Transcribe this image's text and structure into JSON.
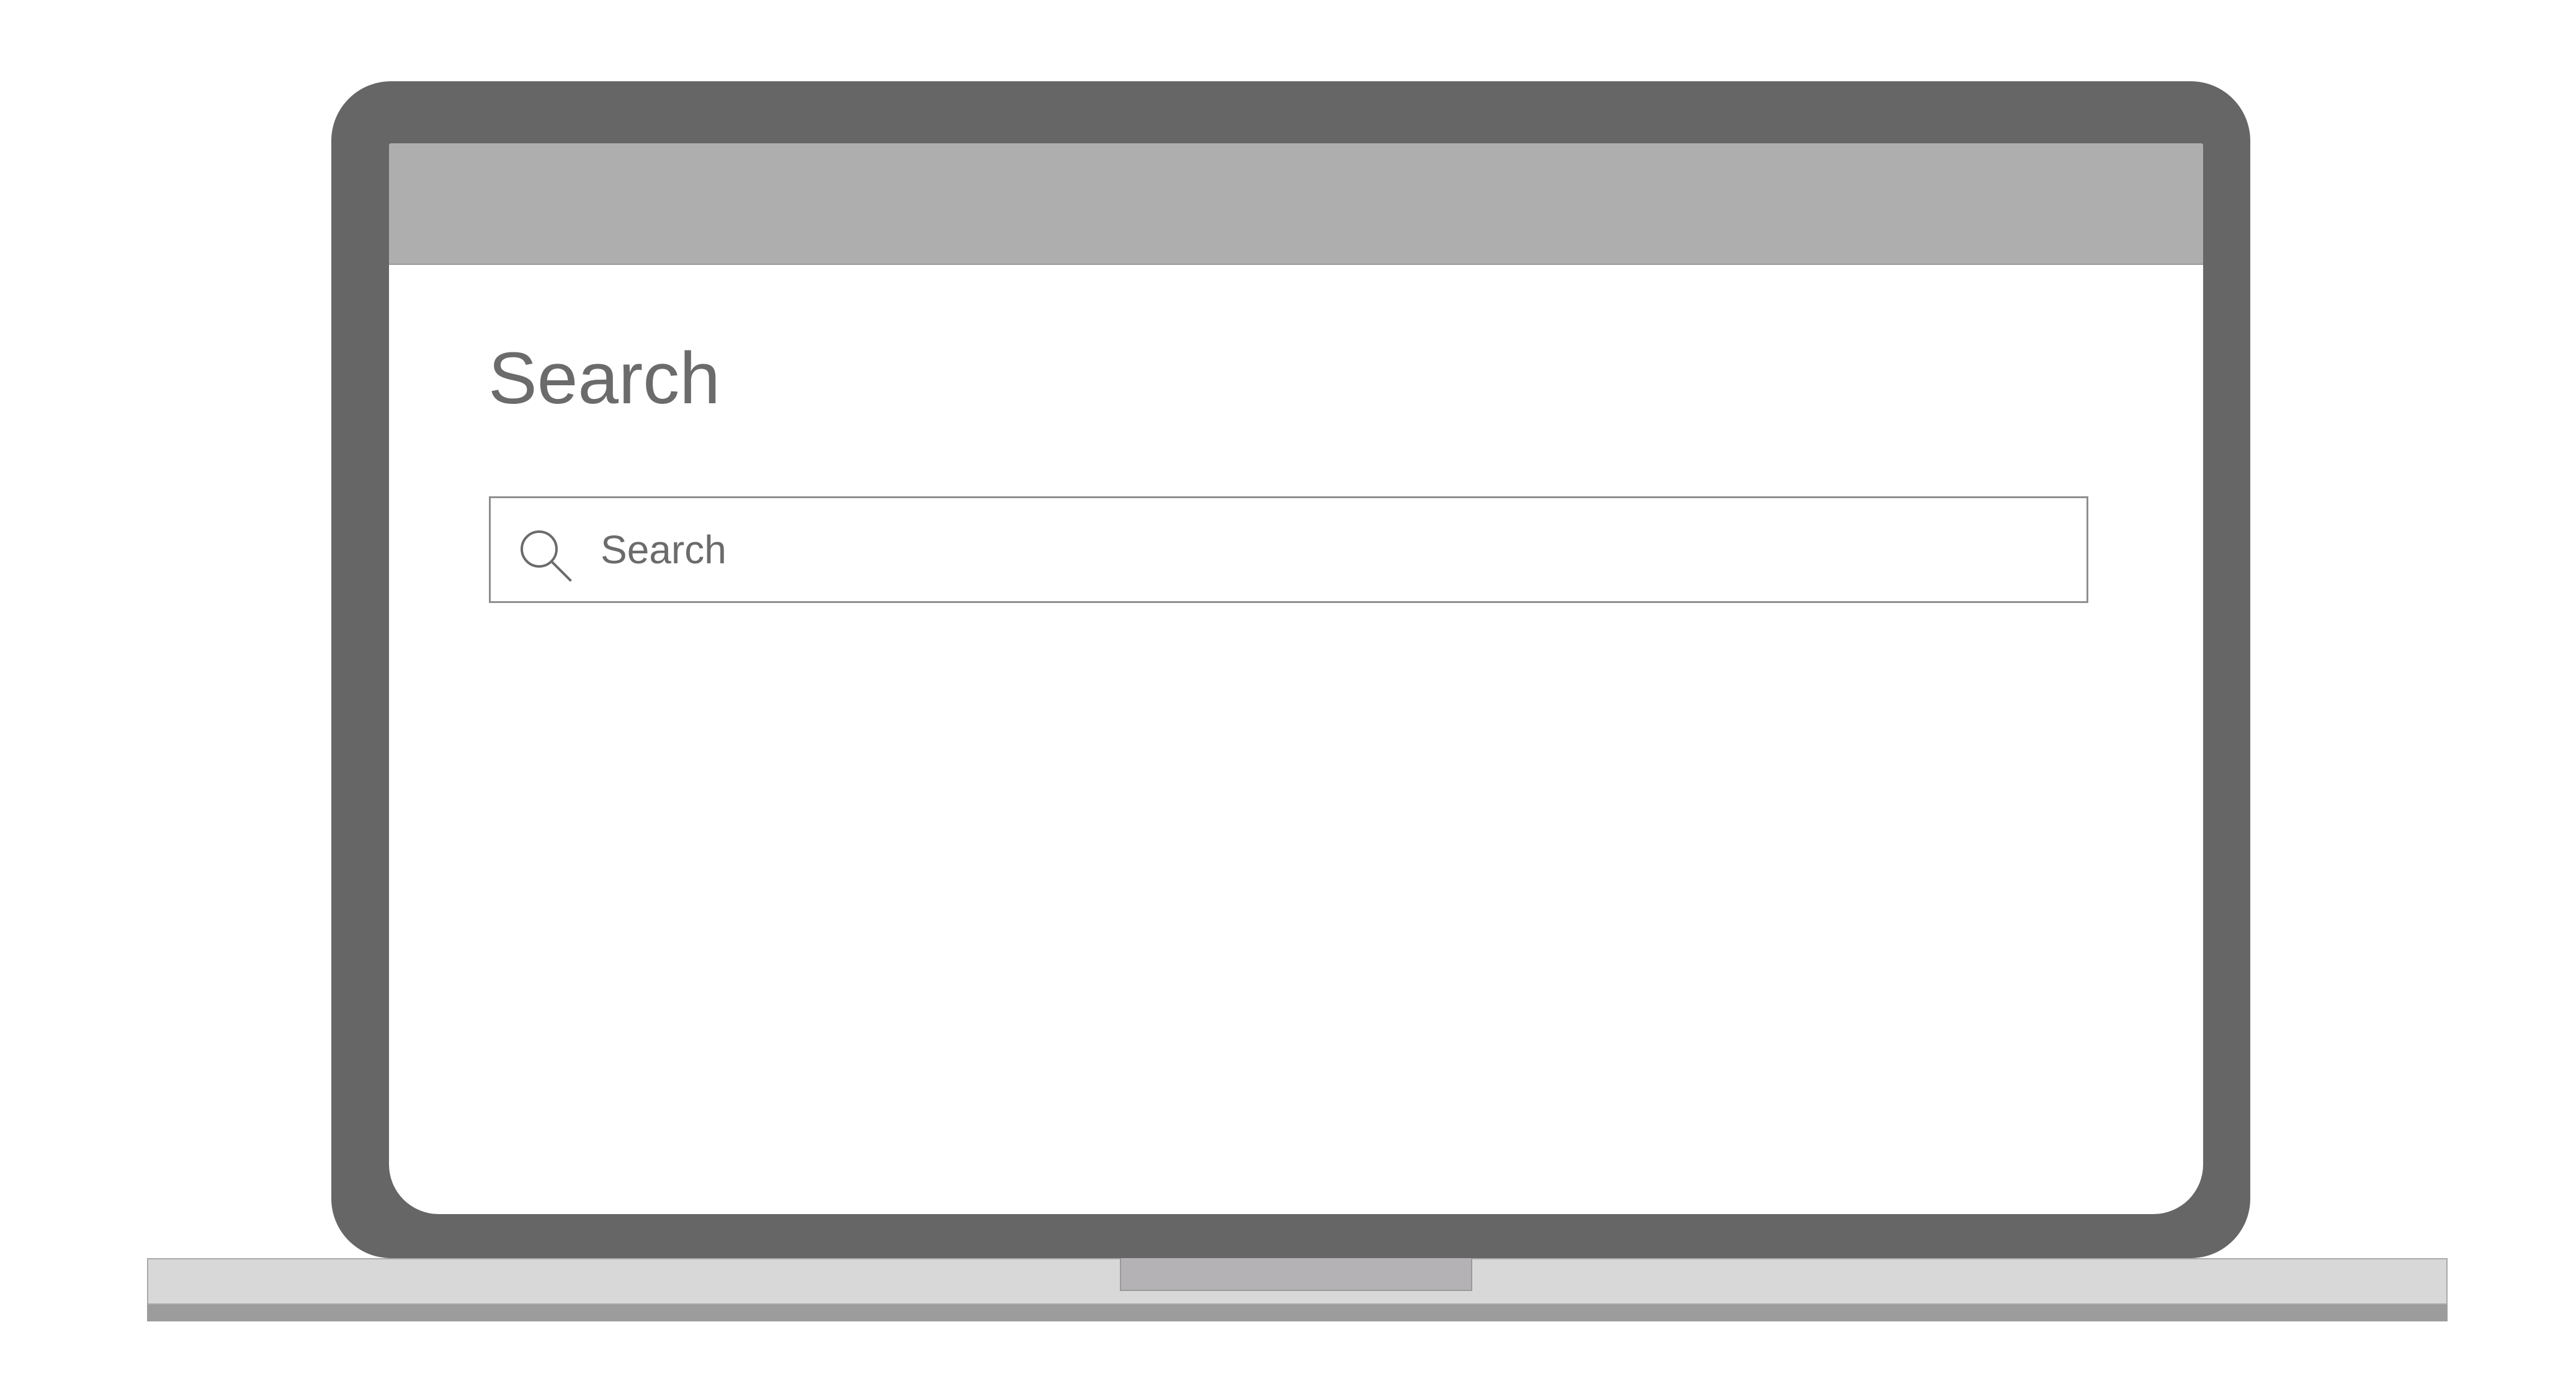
{
  "page": {
    "title": "Search"
  },
  "search": {
    "placeholder": "Search",
    "icon": "search-icon"
  },
  "colors": {
    "bezel": "#666666",
    "browser_bar": "#aeaeae",
    "text": "#6b6b6b",
    "input_border": "#8f8f8f",
    "base": "#d8d8d8",
    "base_edge": "#9c9c9c",
    "notch": "#b4b2b5"
  }
}
